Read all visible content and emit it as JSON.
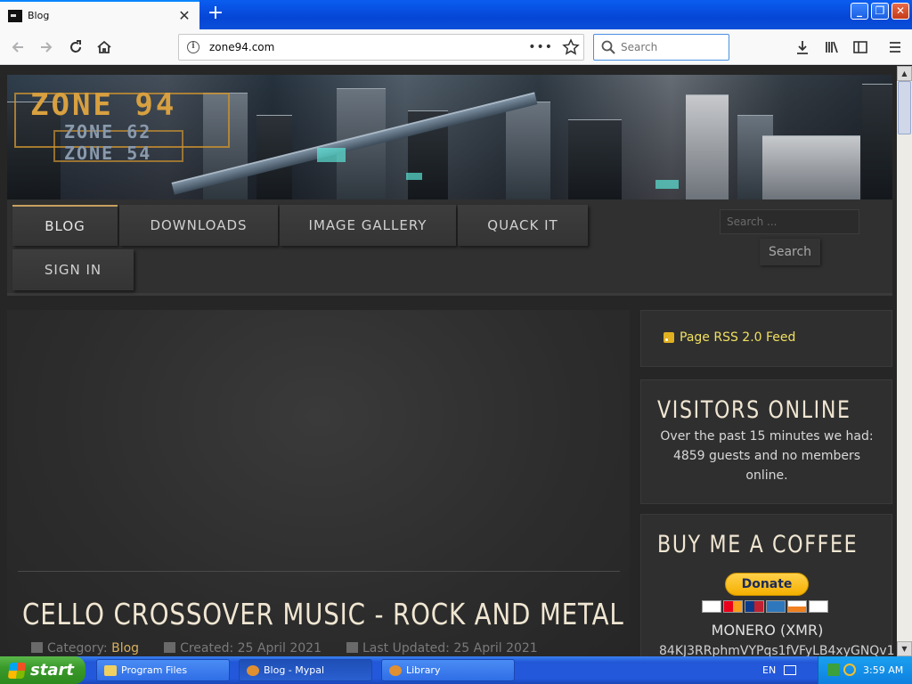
{
  "browser": {
    "tab_title": "Blog",
    "new_tab_symbol": "+",
    "url": "zone94.com",
    "search_placeholder": "Search",
    "more_symbol": "•••"
  },
  "site": {
    "logo_main": "ZONE 94",
    "logo_sub_1": "ZONE 62",
    "logo_sub_2": "ZONE 54",
    "menu": [
      {
        "label": "BLOG",
        "active": true
      },
      {
        "label": "DOWNLOADS",
        "active": false
      },
      {
        "label": "IMAGE GALLERY",
        "active": false
      },
      {
        "label": "QUACK IT",
        "active": false
      },
      {
        "label": "SIGN IN",
        "active": false
      }
    ],
    "search_placeholder": "Search ...",
    "search_button": "Search"
  },
  "article": {
    "title": "CELLO CROSSOVER MUSIC - ROCK AND METAL",
    "category_label": "Category:",
    "category_value": "Blog",
    "created": "Created: 25 April 2021",
    "updated": "Last Updated: 25 April 2021"
  },
  "sidebar": {
    "rss_label": "Page RSS 2.0 Feed",
    "visitors_title": "VISITORS ONLINE",
    "visitors_text": "Over the past 15 minutes we had: 4859 guests and no members online.",
    "coffee_title": "BUY ME A COFFEE",
    "donate_label": "Donate",
    "monero_label": "MONERO (XMR)",
    "monero_address": "84KJ3RRphmVYPqs1fVFyLB4xyGNQv1"
  },
  "taskbar": {
    "start_label": "start",
    "tasks": [
      {
        "label": "Program Files",
        "active": false
      },
      {
        "label": "Blog - Mypal",
        "active": true
      },
      {
        "label": "Library",
        "active": false
      }
    ],
    "language": "EN",
    "clock": "3:59 AM"
  },
  "colors": {
    "accent_gold": "#d8b060",
    "title_text": "#f0e6d2",
    "xp_blue": "#2458dc",
    "start_green": "#3a9a2a"
  }
}
